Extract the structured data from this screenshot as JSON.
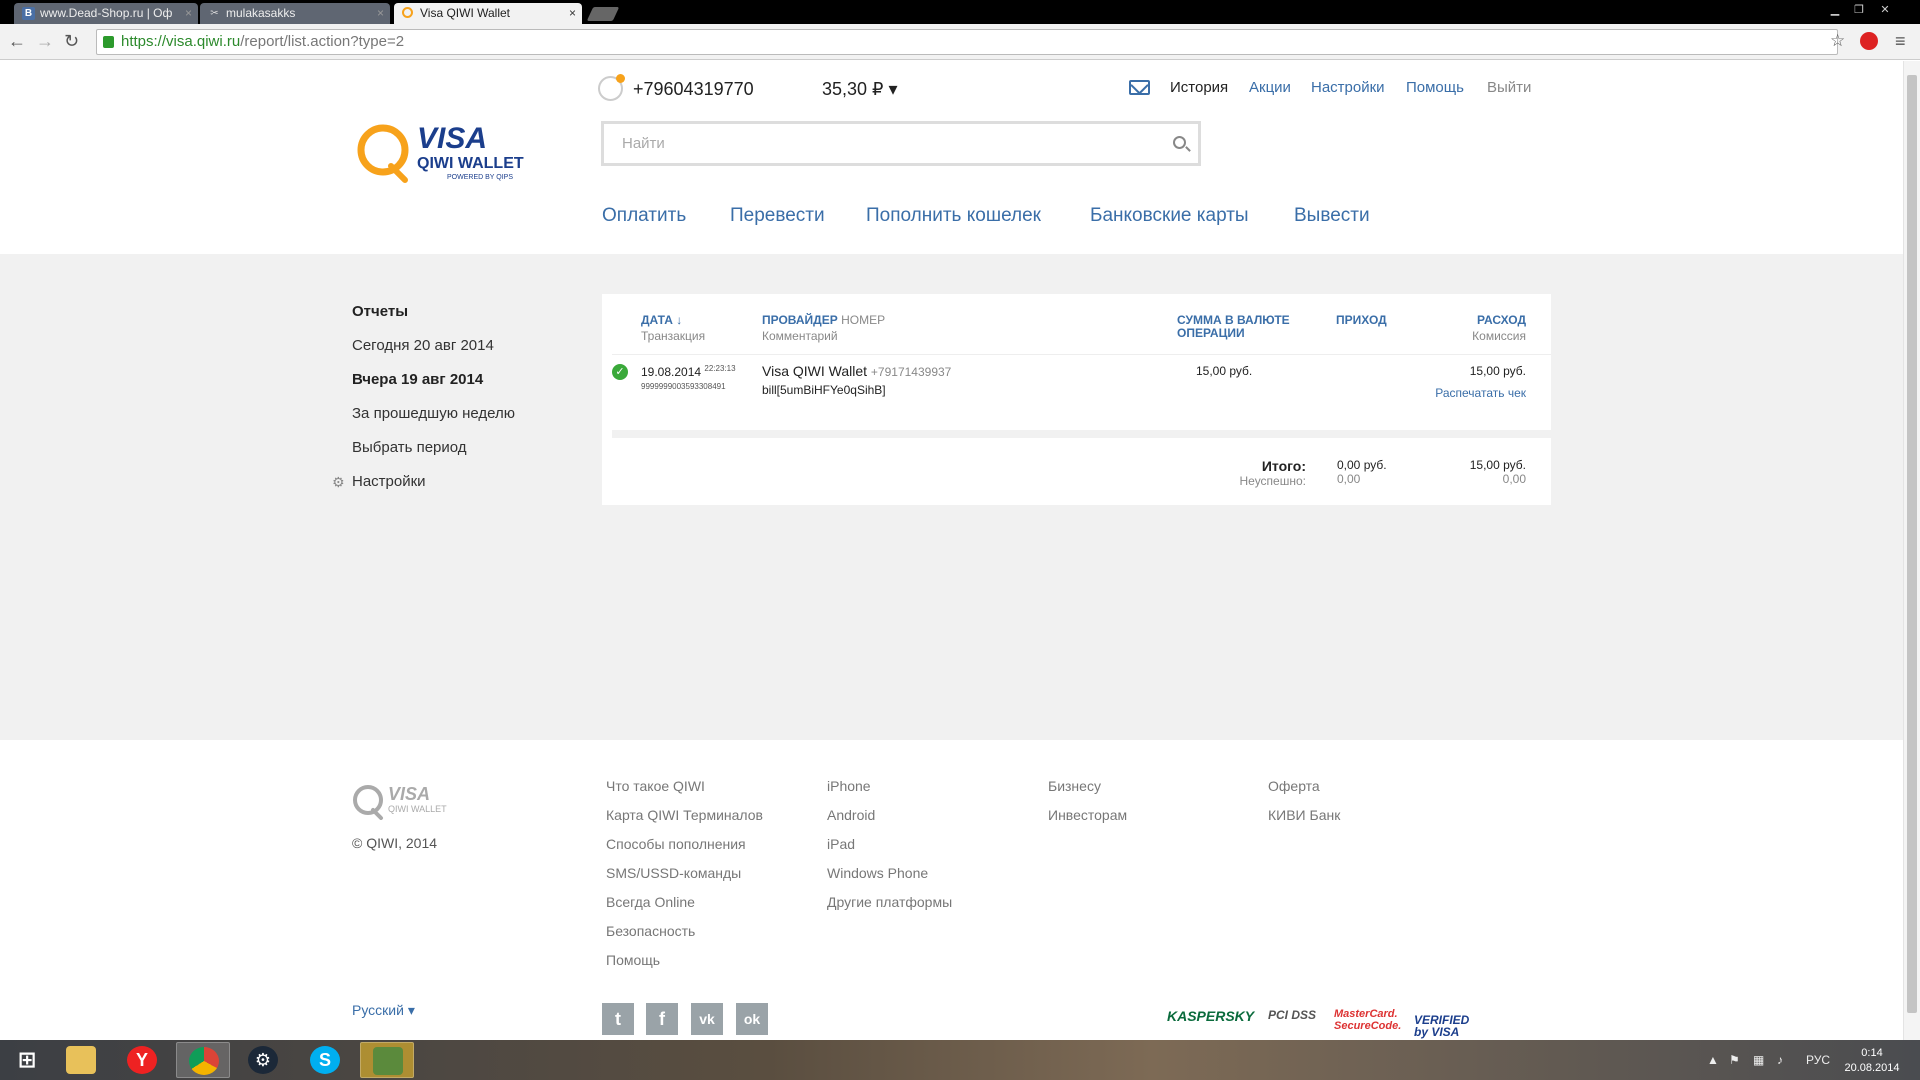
{
  "browser": {
    "tabs": [
      {
        "title": "www.Dead-Shop.ru | Оф",
        "favicon": "vk-icon"
      },
      {
        "title": "mulakasakks",
        "favicon": "tools-icon"
      },
      {
        "title": "Visa QIWI Wallet",
        "favicon": "qiwi-icon",
        "active": true
      }
    ],
    "url_host": "https://visa.qiwi.ru",
    "url_path": "/report/list.action?type=2"
  },
  "header": {
    "logo_visa": "VISA",
    "logo_qiwi": "QIWI WALLET",
    "logo_powered": "POWERED BY QIPS",
    "phone": "+79604319770",
    "balance": "35,30 ₽ ▾",
    "links": {
      "history": "История",
      "promo": "Акции",
      "settings": "Настройки",
      "help": "Помощь",
      "logout": "Выйти"
    },
    "search_placeholder": "Найти",
    "nav": {
      "pay": "Оплатить",
      "transfer": "Перевести",
      "topup": "Пополнить кошелек",
      "cards": "Банковские карты",
      "withdraw": "Вывести"
    }
  },
  "sidebar": {
    "title": "Отчеты",
    "today": "Сегодня 20 авг 2014",
    "yesterday": "Вчера 19 авг 2014",
    "week": "За прошедшую неделю",
    "period": "Выбрать период",
    "settings": "Настройки"
  },
  "report": {
    "columns": {
      "date": "ДАТА ↓",
      "date_sub": "Транзакция",
      "provider": "ПРОВАЙДЕР",
      "number": "НОМЕР",
      "provider_sub": "Комментарий",
      "amount_line1": "СУММА В ВАЛЮТЕ",
      "amount_line2": "ОПЕРАЦИИ",
      "income": "ПРИХОД",
      "expense": "РАСХОД",
      "expense_sub": "Комиссия"
    },
    "row": {
      "date": "19.08.2014",
      "time": "22:23:13",
      "txn": "9999999003593308491",
      "provider": "Visa QIWI Wallet",
      "number": "+79171439937",
      "comment": "bill[5umBiHFYe0qSihB]",
      "amount": "15,00 руб.",
      "expense": "15,00 руб.",
      "print": "Распечатать чек"
    },
    "totals": {
      "label": "Итого:",
      "failed_label": "Неуспешно:",
      "income": "0,00 руб.",
      "income_failed": "0,00",
      "expense": "15,00 руб.",
      "expense_failed": "0,00"
    }
  },
  "footer": {
    "logo_visa": "VISA",
    "logo_qiwi": "QIWI WALLET",
    "copyright": "© QIWI, 2014",
    "col1": [
      "Что такое QIWI",
      "Карта QIWI Терминалов",
      "Способы пополнения",
      "SMS/USSD-команды",
      "Всегда Online",
      "Безопасность",
      "Помощь"
    ],
    "col2": [
      "iPhone",
      "Android",
      "iPad",
      "Windows Phone",
      "Другие платформы"
    ],
    "col3": [
      "Бизнесу",
      "Инвесторам"
    ],
    "col4": [
      "Оферта",
      "КИВИ Банк"
    ],
    "language": "Русский ▾",
    "social_glyphs": {
      "twitter": "t",
      "facebook": "f",
      "vk": "vk",
      "ok": "ok"
    },
    "badges": {
      "kaspersky": "KASPERSKY",
      "pci": "PCI DSS",
      "mastercard": "MasterCard. SecureCode.",
      "visa": "VERIFIED by VISA"
    }
  },
  "taskbar": {
    "lang": "РУС",
    "time": "0:14",
    "date": "20.08.2014"
  },
  "colors": {
    "link": "#3a6ea8",
    "brand_orange": "#f7a21b",
    "brand_blue": "#1b3e8c",
    "success": "#3aa93a"
  }
}
